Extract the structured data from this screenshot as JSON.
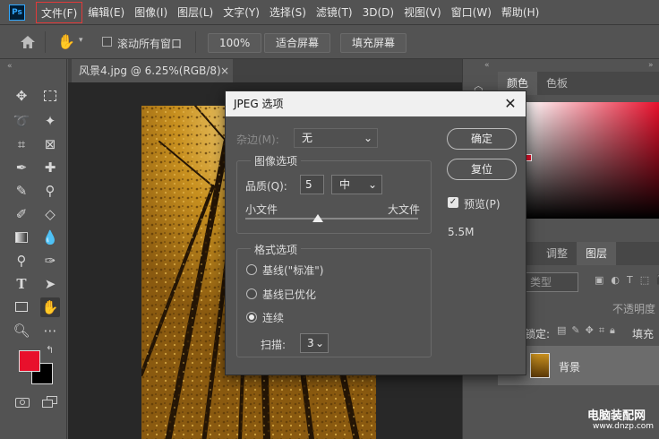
{
  "menu": {
    "logo": "Ps",
    "items": [
      "文件(F)",
      "编辑(E)",
      "图像(I)",
      "图层(L)",
      "文字(Y)",
      "选择(S)",
      "滤镜(T)",
      "3D(D)",
      "视图(V)",
      "窗口(W)",
      "帮助(H)"
    ],
    "active_index": 0
  },
  "options": {
    "scroll_all_windows": "滚动所有窗口",
    "zoom_100": "100%",
    "fit_screen": "适合屏幕",
    "fill_screen": "填充屏幕"
  },
  "document": {
    "tab_title": "风景4.jpg @ 6.25%(RGB/8)",
    "close_glyph": "×"
  },
  "panels": {
    "top_tabs": [
      "颜色",
      "色板"
    ],
    "mid_tabs": [
      "调整",
      "图层"
    ],
    "kind_placeholder": "类型",
    "opacity_label": "不透明度",
    "lock_label": "锁定:",
    "fill_label": "填充",
    "layer_name": "背景"
  },
  "dialog": {
    "title": "JPEG 选项",
    "close_glyph": "✕",
    "matte_label": "杂边(M):",
    "matte_value": "无",
    "ok": "确定",
    "reset": "复位",
    "preview_label": "预览(P)",
    "preview_checked": true,
    "file_size": "5.5M",
    "image_options": {
      "title": "图像选项",
      "quality_label": "品质(Q):",
      "quality_value": "5",
      "quality_level": "中",
      "small_file": "小文件",
      "large_file": "大文件",
      "quality_fraction": 0.42
    },
    "format_options": {
      "title": "格式选项",
      "radios": [
        "基线(\"标准\")",
        "基线已优化",
        "连续"
      ],
      "selected_index": 2,
      "scans_label": "扫描:",
      "scans_value": "3"
    }
  },
  "watermark": {
    "line1": "电脑装配网",
    "line2": "www.dnzp.com"
  },
  "colors": {
    "foreground": "#e8102c",
    "background": "#000000",
    "menu_highlight": "#e03a3a"
  }
}
